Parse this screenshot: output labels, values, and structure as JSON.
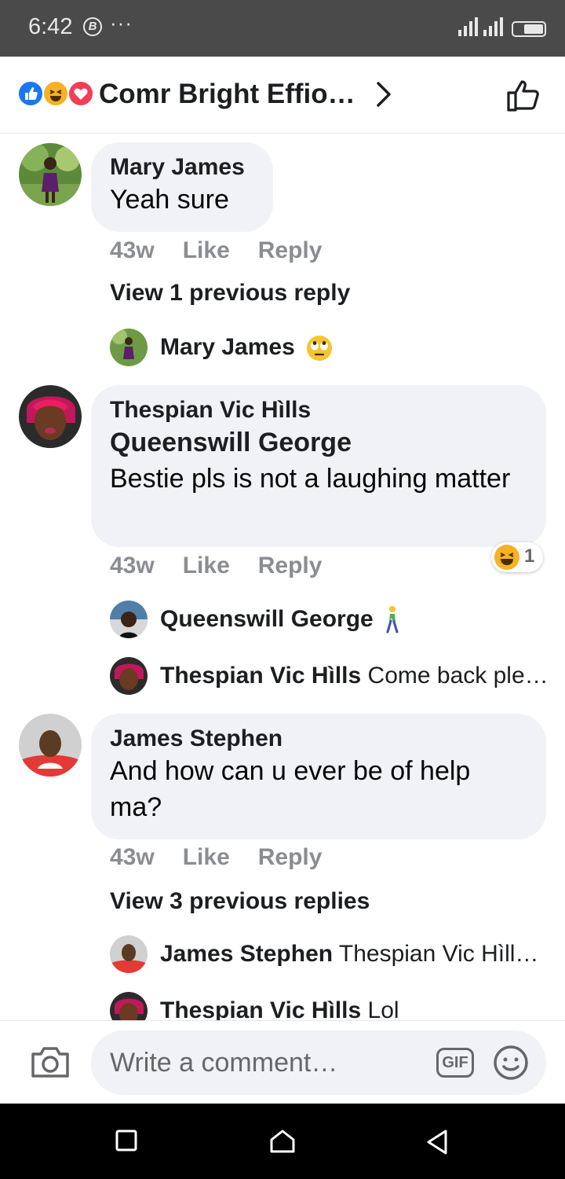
{
  "status_bar": {
    "time": "6:42",
    "badge": "B",
    "more": "···"
  },
  "header": {
    "reaction_icons": [
      "like-icon",
      "haha-icon",
      "love-icon"
    ],
    "title": "Comr Bright Effio…"
  },
  "comments": [
    {
      "author": "Mary James",
      "text": "Yeah sure",
      "time": "43w",
      "like_label": "Like",
      "reply_label": "Reply",
      "view_previous": "View 1 previous reply",
      "replies": [
        {
          "author": "Mary James",
          "text": "",
          "emoji": "rolling-eyes-emoji"
        }
      ]
    },
    {
      "author": "Thespian Vic Hìlls",
      "mention": "Queenswill George",
      "text": "Bestie pls is not a laughing matter",
      "time": "43w",
      "like_label": "Like",
      "reply_label": "Reply",
      "reaction_count": "1",
      "replies": [
        {
          "author": "Queenswill George",
          "text": "",
          "emoji": "person-walking-emoji"
        },
        {
          "author": "Thespian Vic Hìlls",
          "text": "Come back ple…"
        }
      ]
    },
    {
      "author": "James Stephen",
      "text": "And how can u ever be of help ma?",
      "time": "43w",
      "like_label": "Like",
      "reply_label": "Reply",
      "view_previous": "View 3 previous replies",
      "replies": [
        {
          "author": "James Stephen",
          "text": "Thespian Vic Hìll…"
        },
        {
          "author": "Thespian Vic Hìlls",
          "text": "Lol"
        }
      ]
    }
  ],
  "composer": {
    "placeholder": "Write a comment…",
    "gif_label": "GIF"
  },
  "colors": {
    "bubble": "#f0f2f5",
    "meta_text": "#8a8d91",
    "facebook_blue": "#1877f2"
  }
}
